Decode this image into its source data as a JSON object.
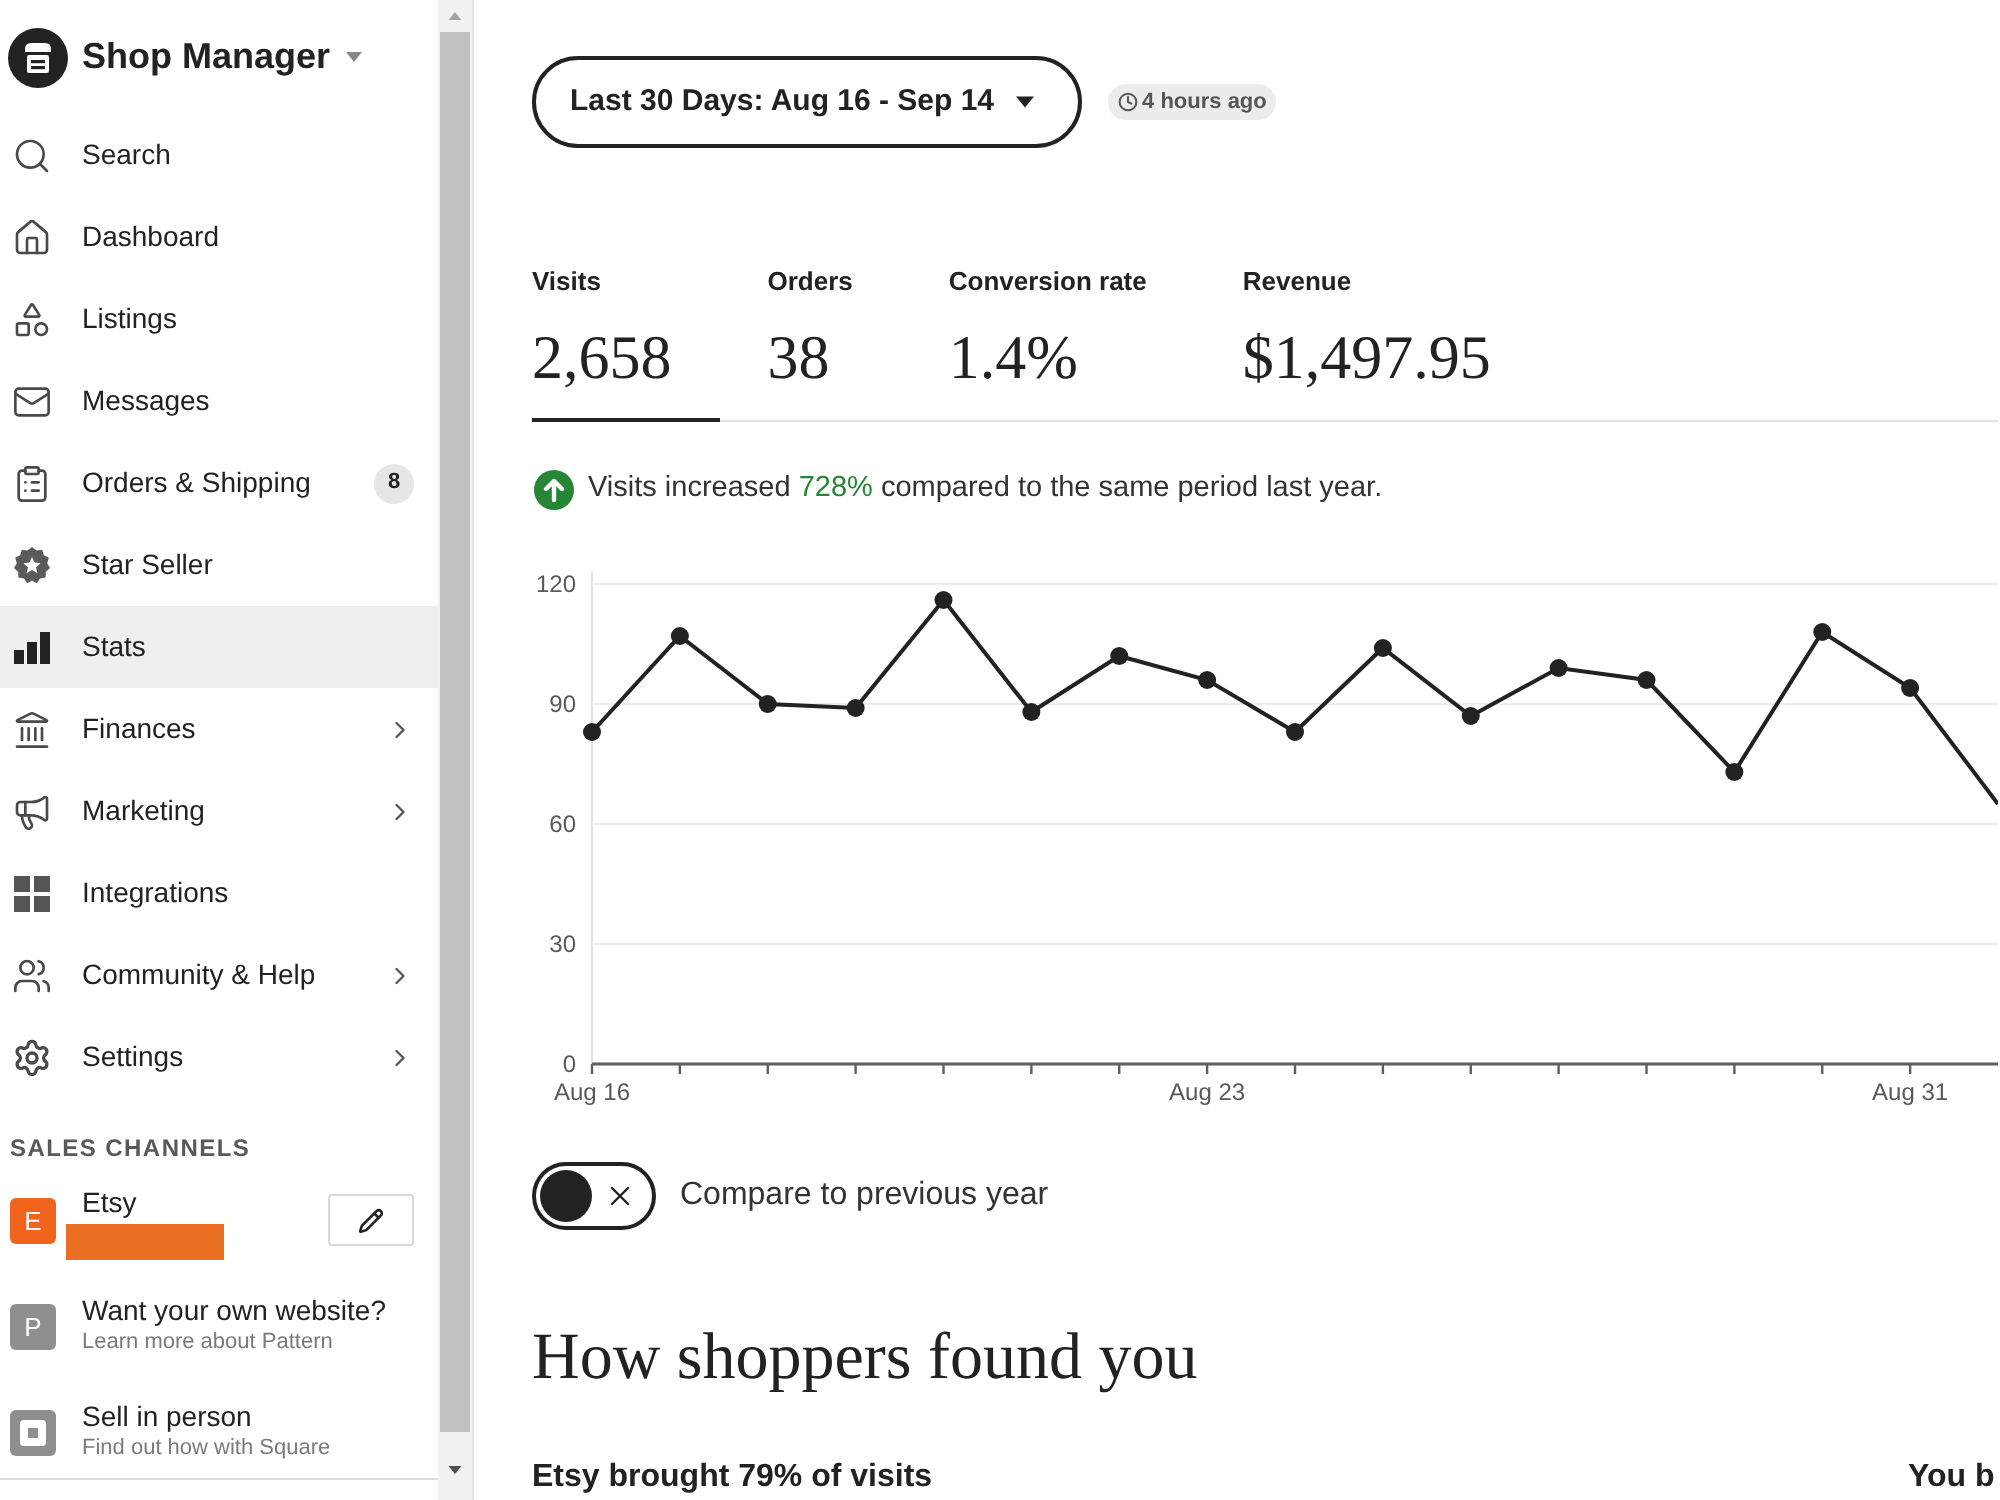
{
  "sidebar": {
    "title": "Shop Manager",
    "nav_items": [
      {
        "label": "Search",
        "selected": false,
        "submenu": false
      },
      {
        "label": "Dashboard",
        "selected": false,
        "submenu": false
      },
      {
        "label": "Listings",
        "selected": false,
        "submenu": false
      },
      {
        "label": "Messages",
        "selected": false,
        "submenu": false
      },
      {
        "label": "Orders & Shipping",
        "selected": false,
        "submenu": false,
        "badge": "8"
      },
      {
        "label": "Star Seller",
        "selected": false,
        "submenu": false
      },
      {
        "label": "Stats",
        "selected": true,
        "submenu": false
      },
      {
        "label": "Finances",
        "selected": false,
        "submenu": true
      },
      {
        "label": "Marketing",
        "selected": false,
        "submenu": true
      },
      {
        "label": "Integrations",
        "selected": false,
        "submenu": false
      },
      {
        "label": "Community & Help",
        "selected": false,
        "submenu": true
      },
      {
        "label": "Settings",
        "selected": false,
        "submenu": true
      }
    ],
    "sales_channels": {
      "heading": "SALES CHANNELS",
      "channels": [
        {
          "kind": "store",
          "initial": "E",
          "color": "#f1641e",
          "name": "Etsy",
          "redacted": true
        },
        {
          "kind": "promo",
          "initial": "P",
          "color": "#8f8f8f",
          "title": "Want your own website?",
          "subtitle": "Learn more about Pattern"
        },
        {
          "kind": "promo-icon",
          "title": "Sell in person",
          "subtitle": "Find out how with Square"
        }
      ]
    }
  },
  "date_range": {
    "label": "Last 30 Days: Aug 16 - Sep 14",
    "updated": "4 hours ago"
  },
  "metrics": [
    {
      "label": "Visits",
      "value": "2,658",
      "selected": true
    },
    {
      "label": "Orders",
      "value": "38",
      "selected": false
    },
    {
      "label": "Conversion rate",
      "value": "1.4%",
      "selected": false
    },
    {
      "label": "Revenue",
      "value": "$1,497.95",
      "selected": false
    }
  ],
  "insight": {
    "increased": true,
    "before": "Visits increased",
    "change": "728%",
    "after": "compared to the same period last year."
  },
  "chart": {
    "chart_data": {
      "type": "line",
      "categories": [
        "Aug 16",
        null,
        null,
        null,
        null,
        null,
        null,
        "Aug 23",
        null,
        null,
        null,
        null,
        null,
        null,
        null,
        "Aug 31",
        null
      ],
      "series": [
        {
          "color": "#222222",
          "marker": "circle",
          "values": [
            83,
            107,
            90,
            89,
            116,
            88,
            102,
            96,
            83,
            104,
            87,
            99,
            96,
            73,
            108,
            94,
            65
          ]
        }
      ],
      "ylim": [
        0,
        120
      ],
      "yticks": [
        0,
        30,
        60,
        90,
        120
      ],
      "grid": true
    }
  },
  "compare_toggle": {
    "label": "Compare to previous year",
    "on": false
  },
  "section": {
    "title": "How shoppers found you",
    "column_1_heading": "Etsy brought 79% of visits",
    "column_2_heading": "You b"
  }
}
